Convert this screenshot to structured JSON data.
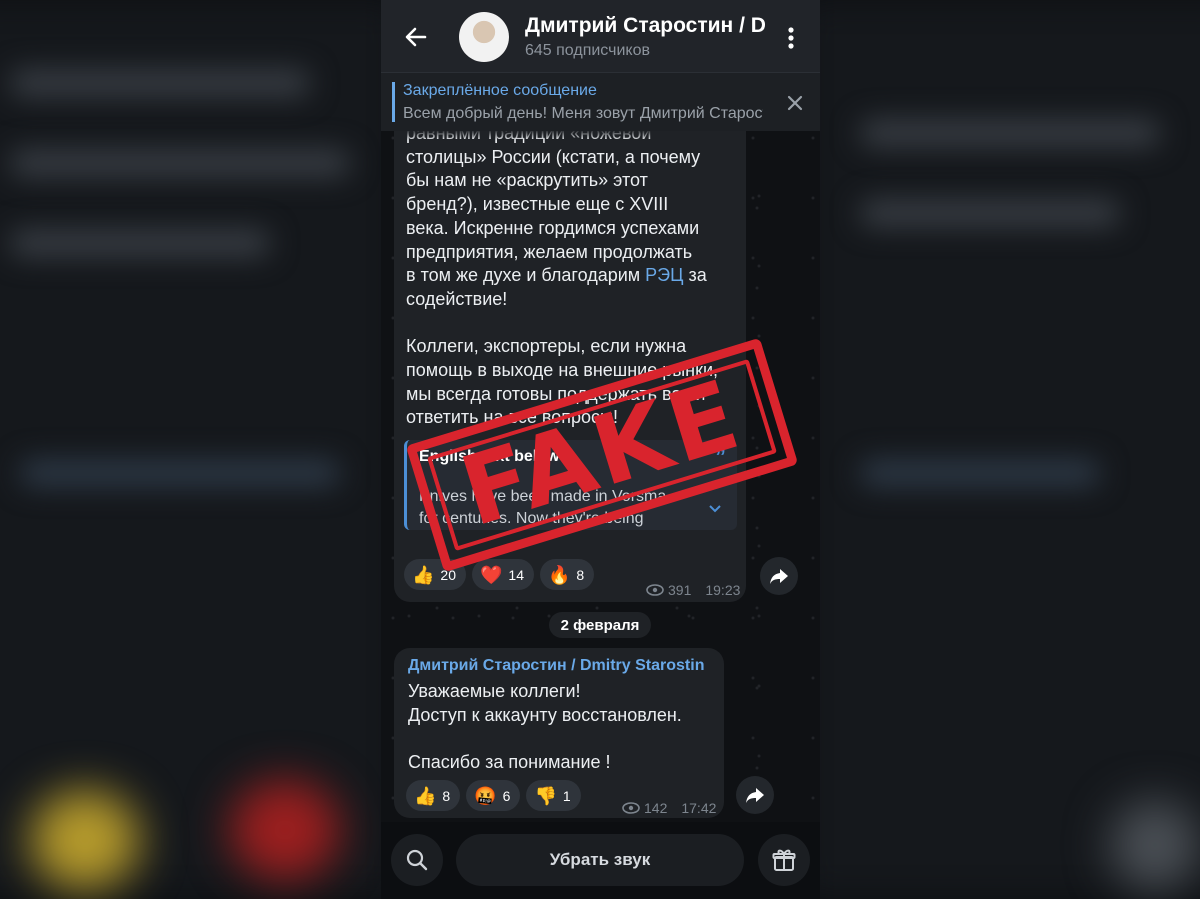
{
  "channel": {
    "title": "Дмитрий Старостин / Dmitry Starostin",
    "subscribers": "645 подписчиков"
  },
  "pinned": {
    "title": "Закреплённое сообщение",
    "text": "Всем добрый день!  Меня зовут Дмитрий Старостин"
  },
  "post1": {
    "text_before_link": "равными традиции «ножевой\nстолицы» России (кстати, а почему\nбы нам не «раскрутить» этот\nбренд?), известные еще с XVIII\nвека. Искренне гордимся успехами\nпредприятия, желаем продолжать\nв том же духе и благодарим ",
    "link": "РЭЦ",
    "text_after_link": " за\nсодействие!\n\nКоллеги, экспортеры, если нужна\nпомощь в выходе на внешние рынки,\nмы всегда готовы поддержать вас и\nответить на все вопросы!",
    "quote_title": "English text below",
    "quote_mark": "”",
    "quote_text": "Knives have been made in Vorsma\nfor centuries. Now they're being",
    "reactions": [
      {
        "emoji": "👍",
        "count": "20"
      },
      {
        "emoji": "❤️",
        "count": "14"
      },
      {
        "emoji": "🔥",
        "count": "8"
      }
    ],
    "views": "391",
    "time": "19:23"
  },
  "date_divider": "2 февраля",
  "post2": {
    "author": "Дмитрий Старостин / Dmitry Starostin",
    "text": "Уважаемые коллеги!\nДоступ к аккаунту восстановлен.\n\nСпасибо за понимание !",
    "reactions": [
      {
        "emoji": "👍",
        "count": "8"
      },
      {
        "emoji": "🤬",
        "count": "6"
      },
      {
        "emoji": "👎",
        "count": "1"
      }
    ],
    "views": "142",
    "time": "17:42"
  },
  "bottom": {
    "mute_label": "Убрать звук"
  },
  "stamp": {
    "text": "FAKE",
    "color": "#d9242d"
  },
  "colors": {
    "accent": "#6aa9e8",
    "bubble": "#1f2226",
    "header": "#212429"
  }
}
